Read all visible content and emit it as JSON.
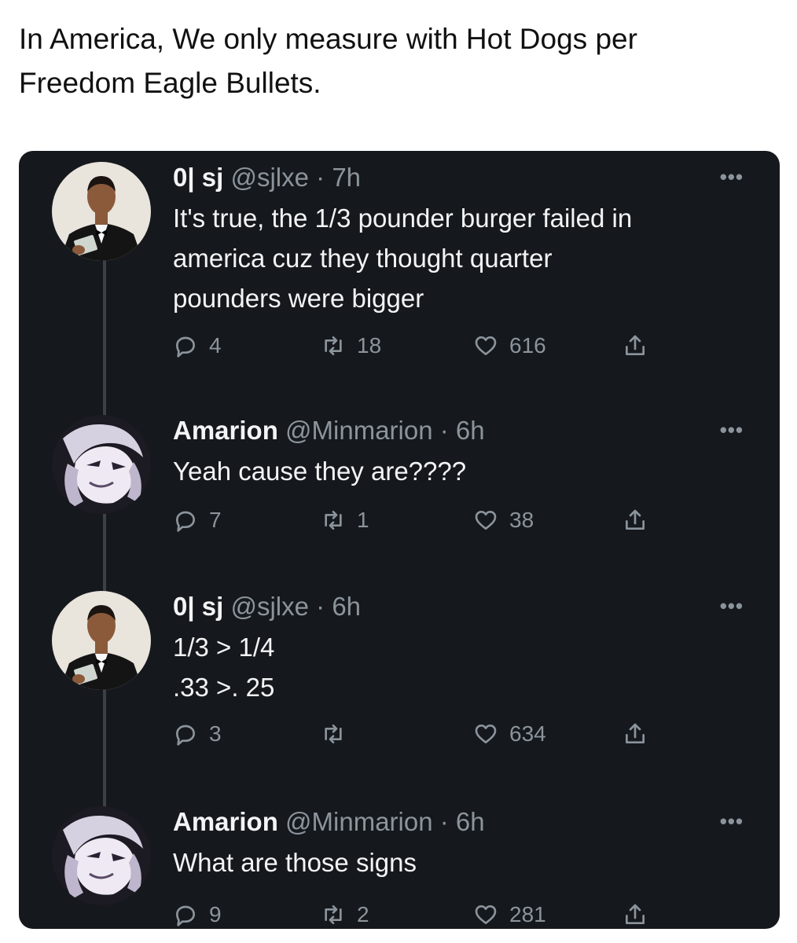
{
  "caption": {
    "line1": "In America, We only measure with Hot Dogs per",
    "line2": "Freedom Eagle Bullets."
  },
  "tweets": [
    {
      "name": "0| sj",
      "handle": "@sjlxe",
      "time": "7h",
      "lines": [
        "It's true, the 1/3 pounder burger failed in",
        "america cuz they thought quarter",
        "pounders were bigger"
      ],
      "replies": "4",
      "retweets": "18",
      "likes": "616",
      "avatar": "man-in-tuxedo"
    },
    {
      "name": "Amarion",
      "handle": "@Minmarion",
      "time": "6h",
      "lines": [
        "Yeah cause they are????"
      ],
      "replies": "7",
      "retweets": "1",
      "likes": "38",
      "avatar": "anime-character"
    },
    {
      "name": "0| sj",
      "handle": "@sjlxe",
      "time": "6h",
      "lines": [
        "1/3 > 1/4",
        ".33 >. 25"
      ],
      "replies": "3",
      "retweets": "",
      "likes": "634",
      "avatar": "man-in-tuxedo"
    },
    {
      "name": "Amarion",
      "handle": "@Minmarion",
      "time": "6h",
      "lines": [
        "What are those signs"
      ],
      "replies": "9",
      "retweets": "2",
      "likes": "281",
      "avatar": "anime-character"
    }
  ],
  "ui": {
    "more_label": "•••",
    "separator": "·"
  },
  "colors": {
    "card_bg": "#15181c",
    "text_primary": "#f2f4f5",
    "text_secondary": "#8b949c",
    "thread_line": "#3a4149"
  }
}
